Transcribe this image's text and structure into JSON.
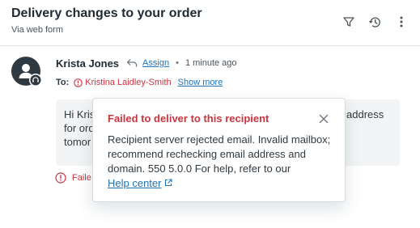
{
  "header": {
    "title": "Delivery changes to your order",
    "subtitle": "Via web form",
    "icons": [
      "filter-icon",
      "history-icon",
      "more-options-icon"
    ]
  },
  "message": {
    "sender_name": "Krista Jones",
    "assign_label": "Assign",
    "separator": "•",
    "timestamp": "1 minute ago",
    "to_label": "To:",
    "recipient": "Kristina Laidley-Smith",
    "show_more_label": "Show more",
    "body_fragments": {
      "line1_start": "Hi Kris",
      "line1_end": "address",
      "line2_start": "for ord",
      "line3_start": "tomor"
    },
    "failure_fragment": "Faile"
  },
  "popover": {
    "title": "Failed to deliver to this recipient",
    "lines": [
      "Recipient server rejected email. Invalid mailbox;",
      "recommend rechecking email address and",
      "domain. 550 5.0.0 For help, refer to our"
    ],
    "help_link": "Help center"
  },
  "colors": {
    "error": "#cc3340",
    "link": "#1f73b7",
    "text": "#2f3941",
    "body_bg": "#f3f4f5"
  }
}
